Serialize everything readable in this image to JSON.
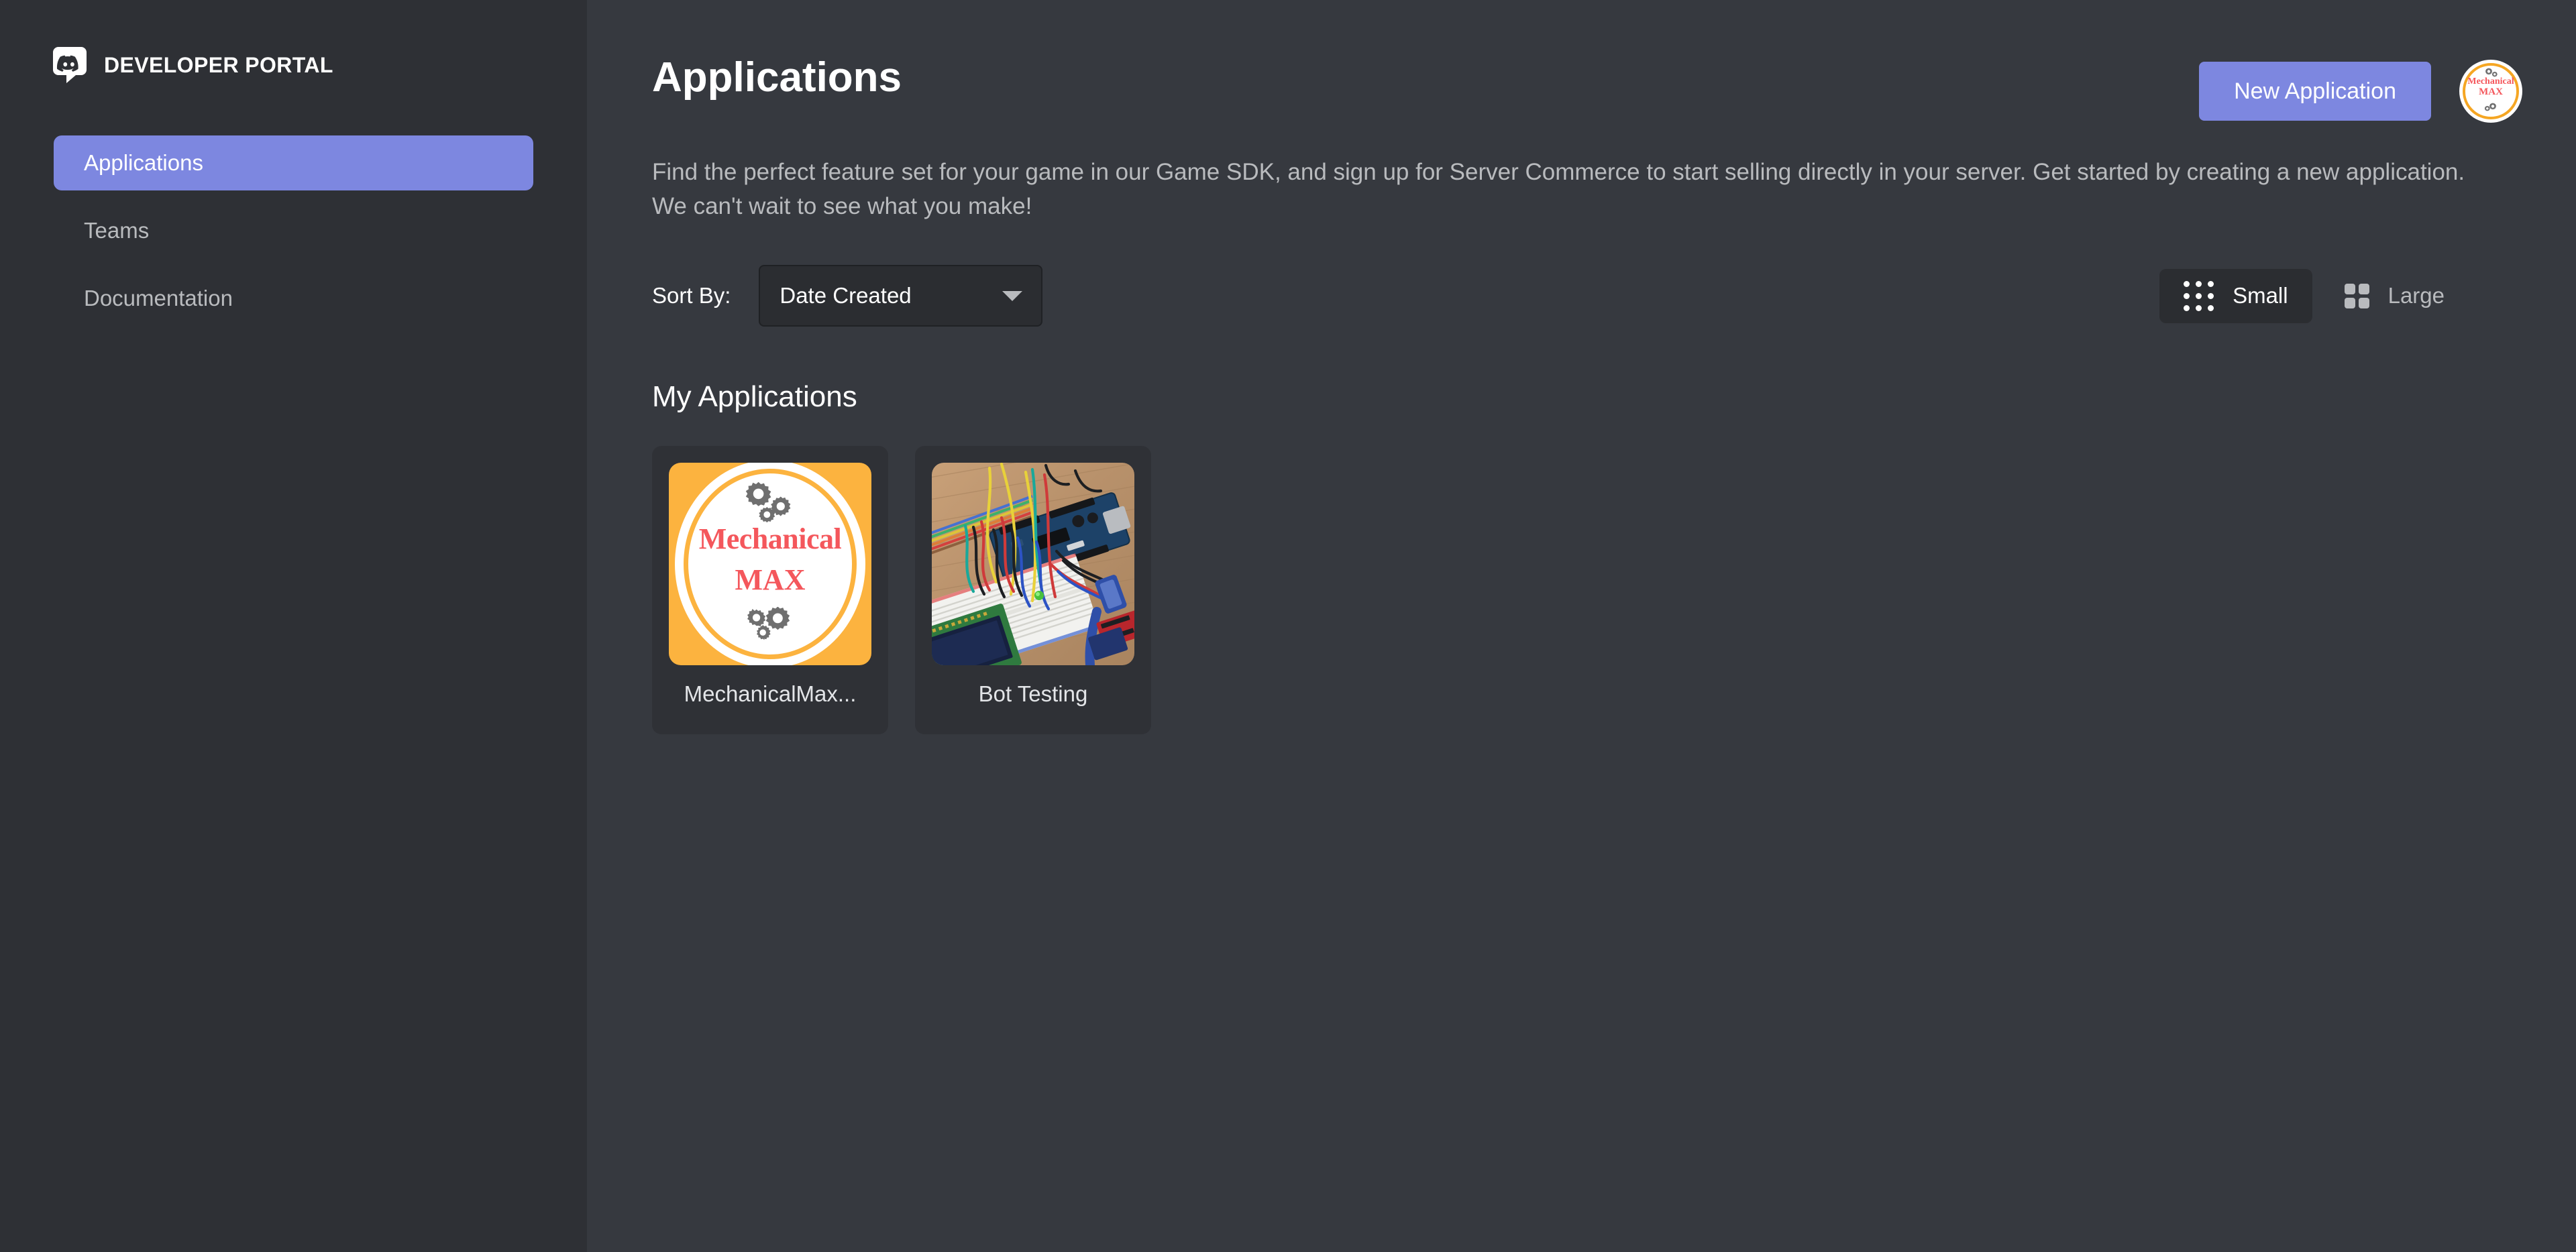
{
  "sidebar": {
    "logo_icon": "discord-logo-icon",
    "brand_title": "DEVELOPER PORTAL",
    "items": [
      {
        "label": "Applications",
        "active": true
      },
      {
        "label": "Teams",
        "active": false
      },
      {
        "label": "Documentation",
        "active": false
      }
    ]
  },
  "header": {
    "title": "Applications",
    "new_application_label": "New Application",
    "avatar": {
      "icon": "user-avatar",
      "line1": "Mechanical",
      "line2": "MAX"
    }
  },
  "description": "Find the perfect feature set for your game in our Game SDK, and sign up for Server Commerce to start selling directly in your server. Get started by creating a new application. We can't wait to see what you make!",
  "controls": {
    "sort_label": "Sort By:",
    "sort_value": "Date Created",
    "sort_options": [
      "Date Created"
    ],
    "caret_icon": "chevron-down-icon",
    "views": [
      {
        "label": "Small",
        "icon": "grid-small-icon",
        "active": true
      },
      {
        "label": "Large",
        "icon": "grid-large-icon",
        "active": false
      }
    ]
  },
  "applications": {
    "section_title": "My Applications",
    "items": [
      {
        "name": "MechanicalMax...",
        "icon": "mechanical-max-logo",
        "logo_line1": "Mechanical",
        "logo_line2": "MAX"
      },
      {
        "name": "Bot Testing",
        "icon": "arduino-breadboard-photo"
      }
    ]
  },
  "colors": {
    "sidebar_bg": "#2e3035",
    "main_bg": "#36393f",
    "accent": "#7d87e0",
    "card_bg": "#2f3136",
    "muted_text": "#b9bbbe",
    "logo_orange": "#fcb33f",
    "logo_red": "#f4575c"
  }
}
